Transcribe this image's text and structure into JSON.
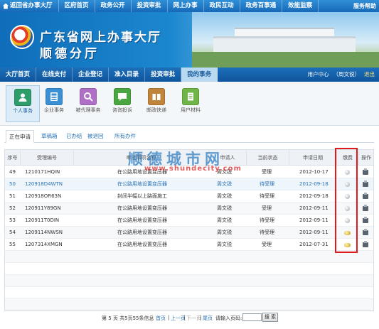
{
  "top_nav": {
    "items": [
      "返回省办事大厅",
      "区府首页",
      "政务公开",
      "投资审批",
      "网上办事",
      "政民互动",
      "政务百事通",
      "效能监察"
    ],
    "help": "服务帮助"
  },
  "banner": {
    "title_line1": "广东省网上办事大厅",
    "title_line2": "顺德分厅"
  },
  "main_nav": {
    "items": [
      "大厅首页",
      "在线支付",
      "企业登记",
      "准入目录",
      "投资审批",
      "我的事务"
    ],
    "active_index": 5,
    "user_center": "用户中心",
    "user_name": "（周文锐）",
    "logout": "退出"
  },
  "icon_tiles": [
    {
      "label": "个人事务",
      "icon": "person-icon",
      "color": "#2e9d6a",
      "active": true
    },
    {
      "label": "企业事务",
      "icon": "calculator-icon",
      "color": "#3b8fd4",
      "active": false
    },
    {
      "label": "被代理事务",
      "icon": "magnifier-icon",
      "color": "#b06fc7",
      "active": false
    },
    {
      "label": "咨询投诉",
      "icon": "chat-icon",
      "color": "#4aa640",
      "active": false
    },
    {
      "label": "邮政快递",
      "icon": "package-icon",
      "color": "#c0853a",
      "active": false
    },
    {
      "label": "用户材料",
      "icon": "folder-icon",
      "color": "#6fb548",
      "active": false
    }
  ],
  "sub_tabs": [
    "正在申请",
    "草稿箱",
    "已办结",
    "被退回",
    "所有办件"
  ],
  "table": {
    "headers": [
      "序号",
      "受理编号",
      "审批事项名称",
      "申请人",
      "当前状态",
      "申请日期",
      "缴费",
      "操作"
    ],
    "rows": [
      {
        "no": "49",
        "id": "1210171HQIN",
        "item": "在公路用地设置变压器",
        "applicant": "周文锐",
        "status": "受理",
        "date": "2012-10-17",
        "fee": "grey"
      },
      {
        "no": "50",
        "id": "120918D4WTN",
        "item": "在公路用地设置变压器",
        "applicant": "周文锐",
        "status": "待受理",
        "date": "2012-09-18",
        "fee": "grey"
      },
      {
        "no": "51",
        "id": "120918OR63N",
        "item": "封闭半幅以上路面施工",
        "applicant": "周文锐",
        "status": "待受理",
        "date": "2012-09-18",
        "fee": "grey"
      },
      {
        "no": "52",
        "id": "120911Y89GN",
        "item": "在公路用地设置变压器",
        "applicant": "周文锐",
        "status": "受理",
        "date": "2012-09-11",
        "fee": "grey"
      },
      {
        "no": "53",
        "id": "120911T0DIN",
        "item": "在公路用地设置变压器",
        "applicant": "周文锐",
        "status": "待受理",
        "date": "2012-09-11",
        "fee": "grey"
      },
      {
        "no": "54",
        "id": "1209114NWSN",
        "item": "在公路用地设置变压器",
        "applicant": "周文锐",
        "status": "待受理",
        "date": "2012-09-11",
        "fee": "gold"
      },
      {
        "no": "55",
        "id": "1207314XMGN",
        "item": "在公路用地设置变压器",
        "applicant": "周文锐",
        "status": "受理",
        "date": "2012-07-31",
        "fee": "gold"
      }
    ]
  },
  "watermark": {
    "title": "顺德城市网",
    "url": "www.shundecity.com"
  },
  "pager": {
    "info": "第 5 页  共5页55条信息",
    "first": "首页",
    "prev": "上一页",
    "next": "下一页",
    "last": "尾页",
    "jump_label": "请输入页码:",
    "go": "搜 索"
  }
}
